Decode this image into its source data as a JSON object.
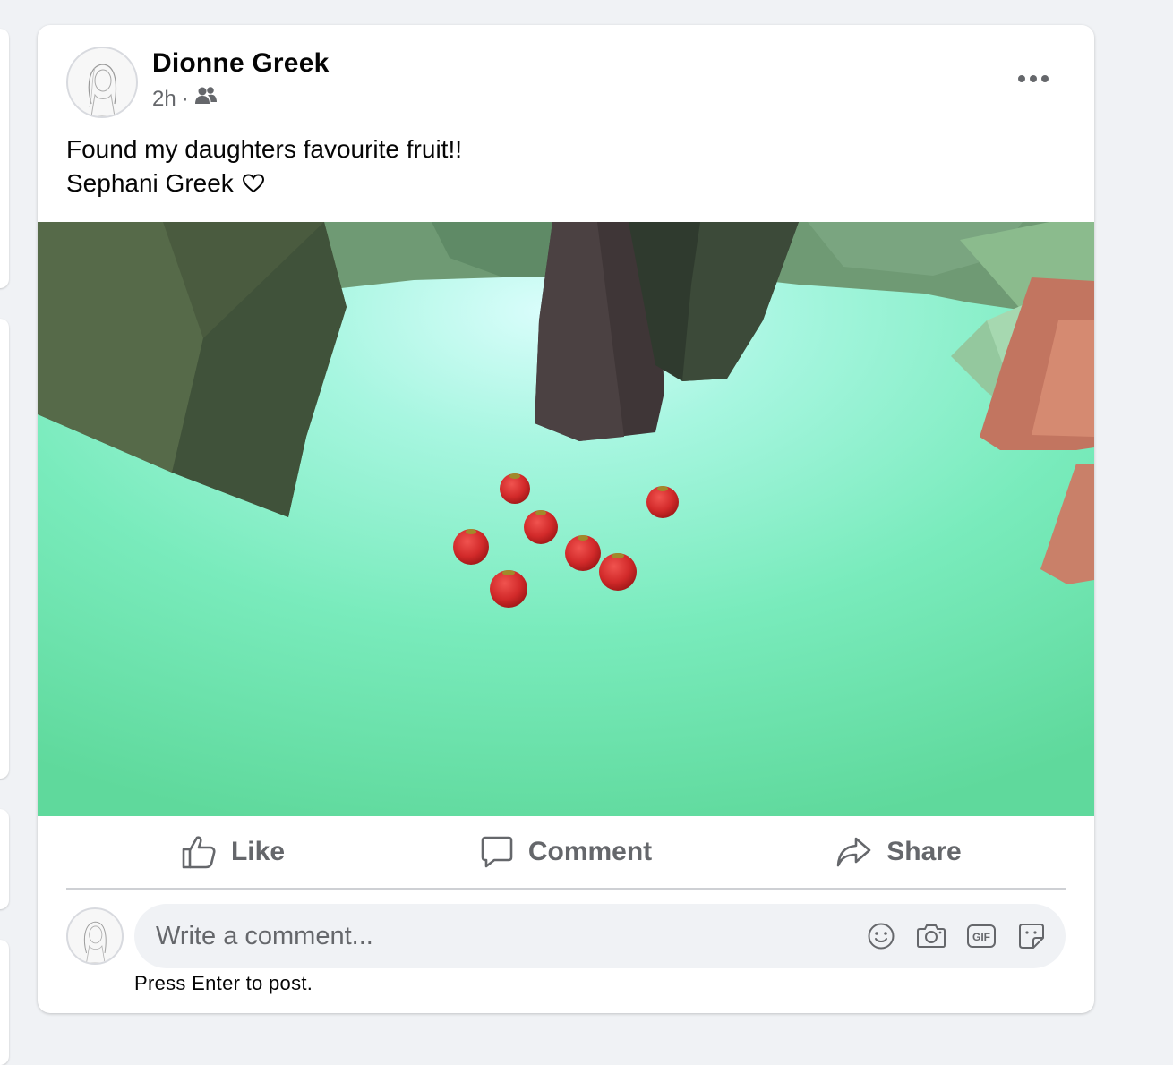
{
  "post": {
    "author": "Dionne Greek",
    "time": "2h",
    "separator": "·",
    "audience_icon": "friends-icon",
    "text_line1": "Found my daughters favourite fruit!!",
    "text_line2": "Sephani Greek",
    "text_emoji": "♡"
  },
  "actions": {
    "like": "Like",
    "comment": "Comment",
    "share": "Share"
  },
  "comment_box": {
    "placeholder": "Write a comment...",
    "icons": [
      "smiley-icon",
      "camera-icon",
      "gif-icon",
      "sticker-icon"
    ],
    "hint": "Press Enter to post."
  },
  "colors": {
    "text_primary": "#050505",
    "text_secondary": "#65676b",
    "background": "#f0f2f5"
  }
}
